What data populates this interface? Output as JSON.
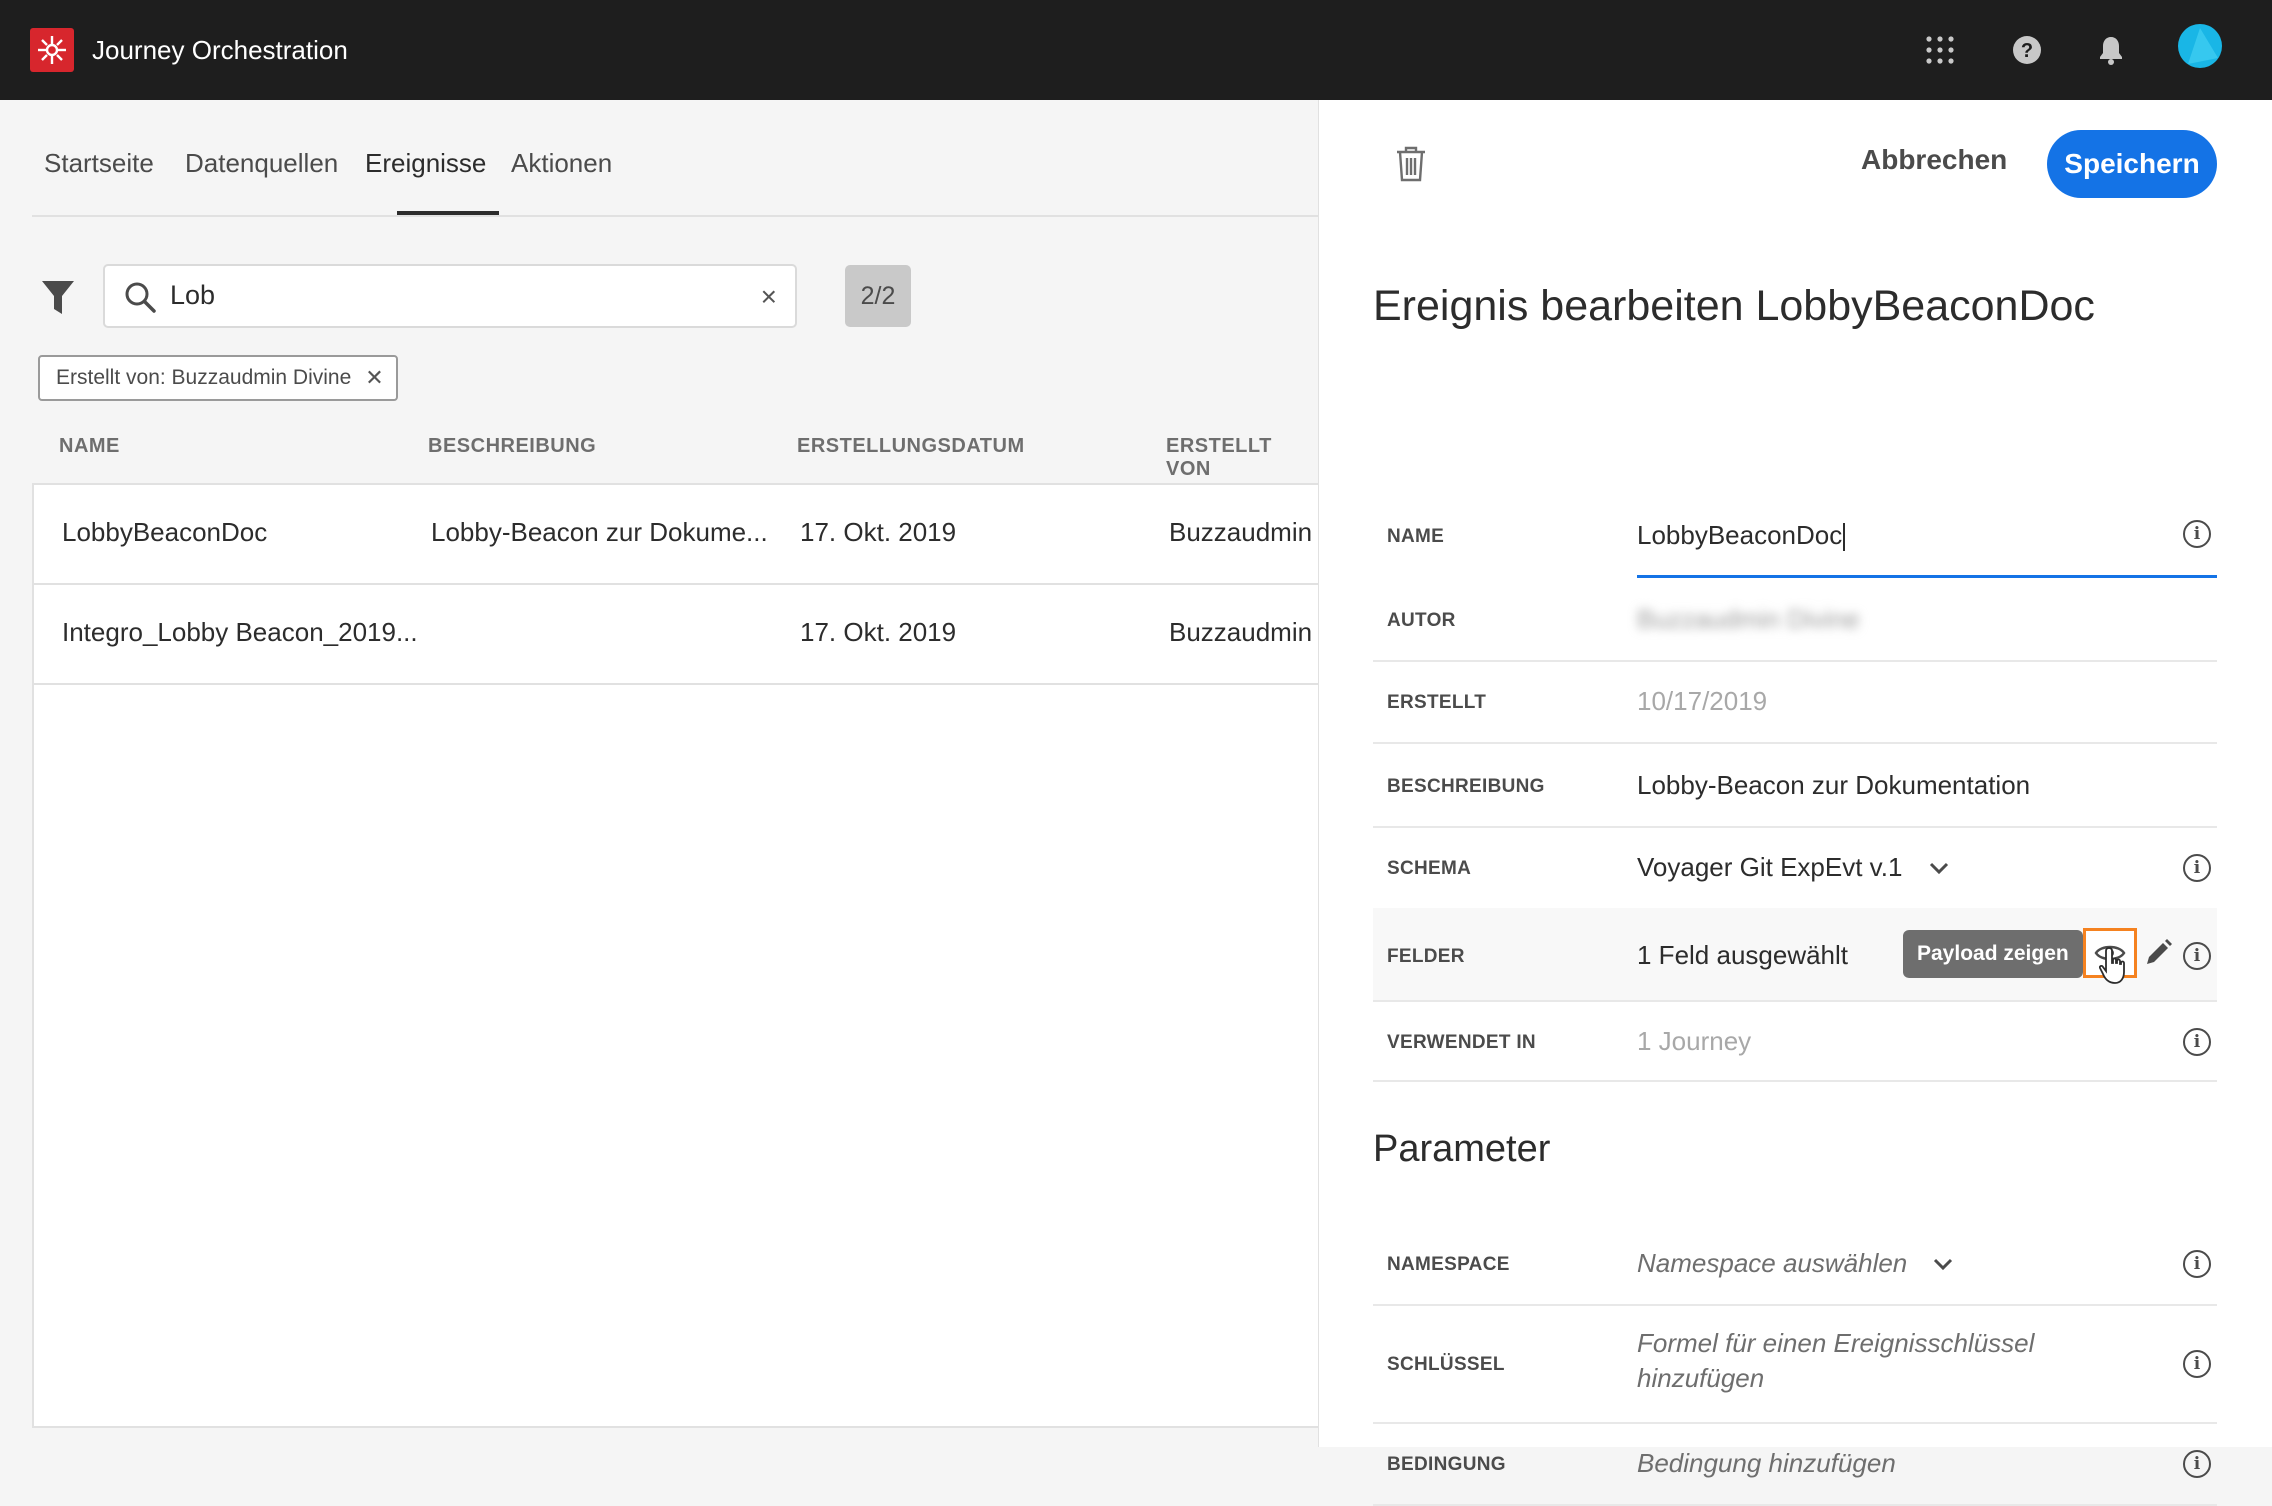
{
  "app": {
    "title": "Journey Orchestration"
  },
  "topbar_icons": [
    "apps-grid-icon",
    "help-icon",
    "bell-icon",
    "avatar"
  ],
  "tabs": [
    {
      "label": "Startseite",
      "active": false
    },
    {
      "label": "Datenquellen",
      "active": false
    },
    {
      "label": "Ereignisse",
      "active": true
    },
    {
      "label": "Aktionen",
      "active": false
    }
  ],
  "search": {
    "value": "Lob",
    "count": "2/2"
  },
  "filter_chip": {
    "label": "Erstellt von: Buzzaudmin Divine"
  },
  "table": {
    "headers": [
      "NAME",
      "BESCHREIBUNG",
      "ERSTELLUNGSDATUM",
      "ERSTELLT VON"
    ],
    "rows": [
      {
        "name": "LobbyBeaconDoc",
        "description": "Lobby-Beacon zur Dokume...",
        "created": "17. Okt. 2019",
        "author": "Buzzaudmin Di"
      },
      {
        "name": "Integro_Lobby Beacon_2019...",
        "description": "",
        "created": "17. Okt. 2019",
        "author": "Buzzaudmin Di"
      }
    ]
  },
  "panel": {
    "cancel_label": "Abbrechen",
    "save_label": "Speichern",
    "title": "Ereignis bearbeiten LobbyBeaconDoc",
    "fields": {
      "name": {
        "label": "NAME",
        "value": "LobbyBeaconDoc"
      },
      "author": {
        "label": "AUTOR",
        "value": "Buzzaudmin Divine"
      },
      "created": {
        "label": "ERSTELLT",
        "value": "10/17/2019"
      },
      "description": {
        "label": "BESCHREIBUNG",
        "value": "Lobby-Beacon zur Dokumentation"
      },
      "schema": {
        "label": "SCHEMA",
        "value": "Voyager Git ExpEvt v.1"
      },
      "fields": {
        "label": "FELDER",
        "value": "1 Feld ausgewählt",
        "tooltip": "Payload zeigen"
      },
      "used_in": {
        "label": "VERWENDET IN",
        "value": "1 Journey"
      }
    },
    "parameters": {
      "title": "Parameter",
      "namespace": {
        "label": "NAMESPACE",
        "placeholder": "Namespace auswählen"
      },
      "key": {
        "label": "SCHLÜSSEL",
        "placeholder_line1": "Formel für einen Ereignisschlüssel",
        "placeholder_line2": "hinzufügen"
      },
      "condition": {
        "label": "BEDINGUNG",
        "placeholder": "Bedingung hinzufügen"
      }
    }
  },
  "colors": {
    "accent": "#1473e6",
    "highlight": "#f58220",
    "brand": "#d7262d",
    "topbar": "#1e1e1e"
  }
}
